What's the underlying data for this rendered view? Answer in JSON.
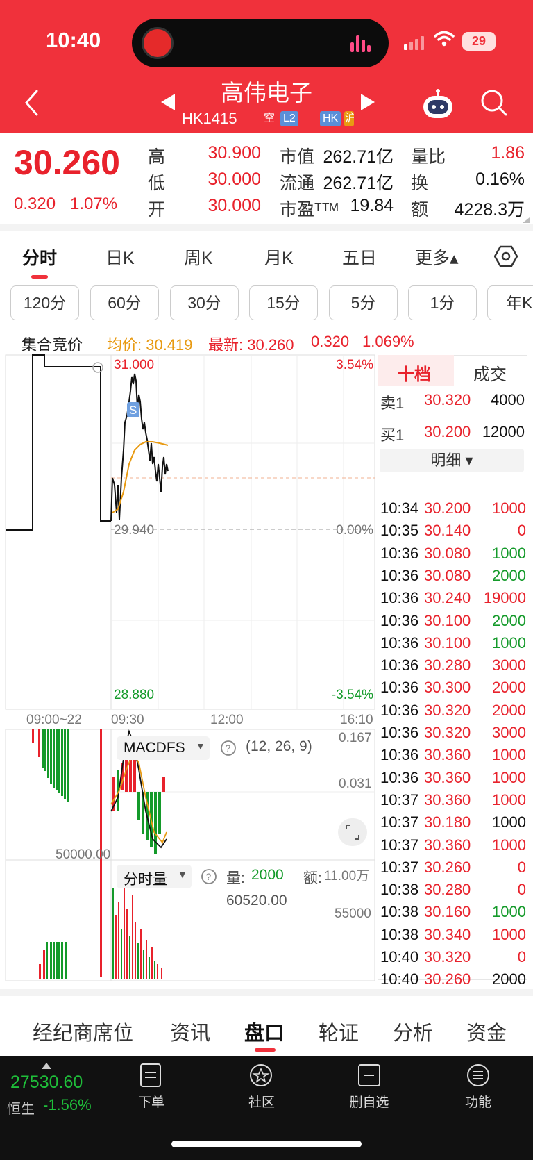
{
  "status_bar": {
    "time": "10:40",
    "battery": "29"
  },
  "header": {
    "title": "高伟电子",
    "code": "HK1415",
    "tags": [
      "空",
      "L2",
      "HK",
      "沪"
    ]
  },
  "quote": {
    "price": "30.260",
    "change": "0.320",
    "change_pct": "1.07%",
    "rows": [
      {
        "l1": "高",
        "v1": "30.900",
        "l2": "市值",
        "v2": "262.71亿",
        "l3": "量比",
        "v3": "1.86"
      },
      {
        "l1": "低",
        "v1": "30.000",
        "l2": "流通",
        "v2": "262.71亿",
        "l3": "换",
        "v3": "0.16%"
      },
      {
        "l1": "开",
        "v1": "30.000",
        "l2": "市盈ᵀᵀᴹ",
        "v2": "19.84",
        "l3": "额",
        "v3": "4228.3万"
      }
    ]
  },
  "period_tabs": [
    "分时",
    "日K",
    "周K",
    "月K",
    "五日",
    "更多▴"
  ],
  "interval_pills": [
    "120分",
    "60分",
    "30分",
    "15分",
    "5分",
    "1分",
    "年K"
  ],
  "info_row": {
    "label": "集合竞价",
    "avg": "均价: 30.419",
    "latest": "最新: 30.260",
    "chg": "0.320",
    "pct": "1.069%"
  },
  "chart": {
    "y_max": "31.000",
    "y_mid": "29.940",
    "y_min": "28.880",
    "pct_max": "3.54%",
    "pct_mid": "0.00%",
    "pct_min": "-3.54%",
    "time_labels": [
      "09:00~22",
      "09:30",
      "12:00",
      "16:10"
    ],
    "macd": {
      "label": "MACDFS",
      "params": "(12, 26, 9)",
      "top": "0.167",
      "mid": "0.031"
    },
    "volume": {
      "label": "分时量",
      "vol_label": "量:",
      "vol": "2000",
      "amt_label": "额:",
      "amt": "11.00万",
      "avg": "60520.00",
      "left_axis": "50000.00",
      "right_axis": "55000"
    },
    "marker": "S"
  },
  "order_panel": {
    "tabs": [
      "十档",
      "成交"
    ],
    "ask": {
      "label": "卖1",
      "price": "30.320",
      "qty": "4000"
    },
    "bid": {
      "label": "买1",
      "price": "30.200",
      "qty": "12000"
    },
    "detail_label": "明细 ▾",
    "trades": [
      {
        "t": "10:34",
        "p": "30.200",
        "q": "1000",
        "c": "red"
      },
      {
        "t": "10:35",
        "p": "30.140",
        "q": "0",
        "c": "red"
      },
      {
        "t": "10:36",
        "p": "30.080",
        "q": "1000",
        "c": "green"
      },
      {
        "t": "10:36",
        "p": "30.080",
        "q": "2000",
        "c": "green"
      },
      {
        "t": "10:36",
        "p": "30.240",
        "q": "19000",
        "c": "red"
      },
      {
        "t": "10:36",
        "p": "30.100",
        "q": "2000",
        "c": "green"
      },
      {
        "t": "10:36",
        "p": "30.100",
        "q": "1000",
        "c": "green"
      },
      {
        "t": "10:36",
        "p": "30.280",
        "q": "3000",
        "c": "red"
      },
      {
        "t": "10:36",
        "p": "30.300",
        "q": "2000",
        "c": "red"
      },
      {
        "t": "10:36",
        "p": "30.320",
        "q": "2000",
        "c": "red"
      },
      {
        "t": "10:36",
        "p": "30.320",
        "q": "3000",
        "c": "red"
      },
      {
        "t": "10:36",
        "p": "30.360",
        "q": "1000",
        "c": "red"
      },
      {
        "t": "10:36",
        "p": "30.360",
        "q": "1000",
        "c": "red"
      },
      {
        "t": "10:37",
        "p": "30.360",
        "q": "1000",
        "c": "red"
      },
      {
        "t": "10:37",
        "p": "30.180",
        "q": "1000",
        "c": "black"
      },
      {
        "t": "10:37",
        "p": "30.360",
        "q": "1000",
        "c": "red"
      },
      {
        "t": "10:37",
        "p": "30.260",
        "q": "0",
        "c": "red"
      },
      {
        "t": "10:38",
        "p": "30.280",
        "q": "0",
        "c": "red"
      },
      {
        "t": "10:38",
        "p": "30.160",
        "q": "1000",
        "c": "green"
      },
      {
        "t": "10:38",
        "p": "30.340",
        "q": "1000",
        "c": "red"
      },
      {
        "t": "10:40",
        "p": "30.320",
        "q": "0",
        "c": "red"
      },
      {
        "t": "10:40",
        "p": "30.260",
        "q": "2000",
        "c": "black"
      }
    ]
  },
  "bottom_tabs": [
    "经纪商席位",
    "资讯",
    "盘口",
    "轮证",
    "分析",
    "资金"
  ],
  "index": {
    "value": "27530.60",
    "name": "恒生",
    "pct": "-1.56%"
  },
  "nav": [
    "下单",
    "社区",
    "删自选",
    "功能"
  ],
  "colors": {
    "header": "#f0313b",
    "up": "#e8222c",
    "down": "#149a2a",
    "avg_line": "#e89a12"
  }
}
